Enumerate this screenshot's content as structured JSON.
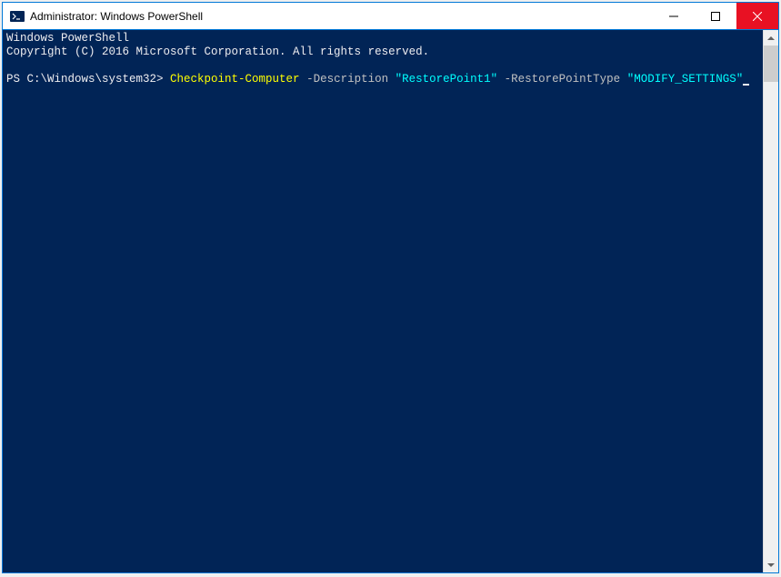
{
  "window": {
    "title": "Administrator: Windows PowerShell"
  },
  "terminal": {
    "banner_line1": "Windows PowerShell",
    "banner_line2": "Copyright (C) 2016 Microsoft Corporation. All rights reserved.",
    "prompt": "PS C:\\Windows\\system32> ",
    "cmd": {
      "cmdlet": "Checkpoint-Computer",
      "sp1": " ",
      "param1": "-Description",
      "sp2": " ",
      "value1": "\"RestorePoint1\"",
      "sp3": " ",
      "param2": "-RestorePointType",
      "sp4": " ",
      "value2": "\"MODIFY_SETTINGS\""
    }
  }
}
